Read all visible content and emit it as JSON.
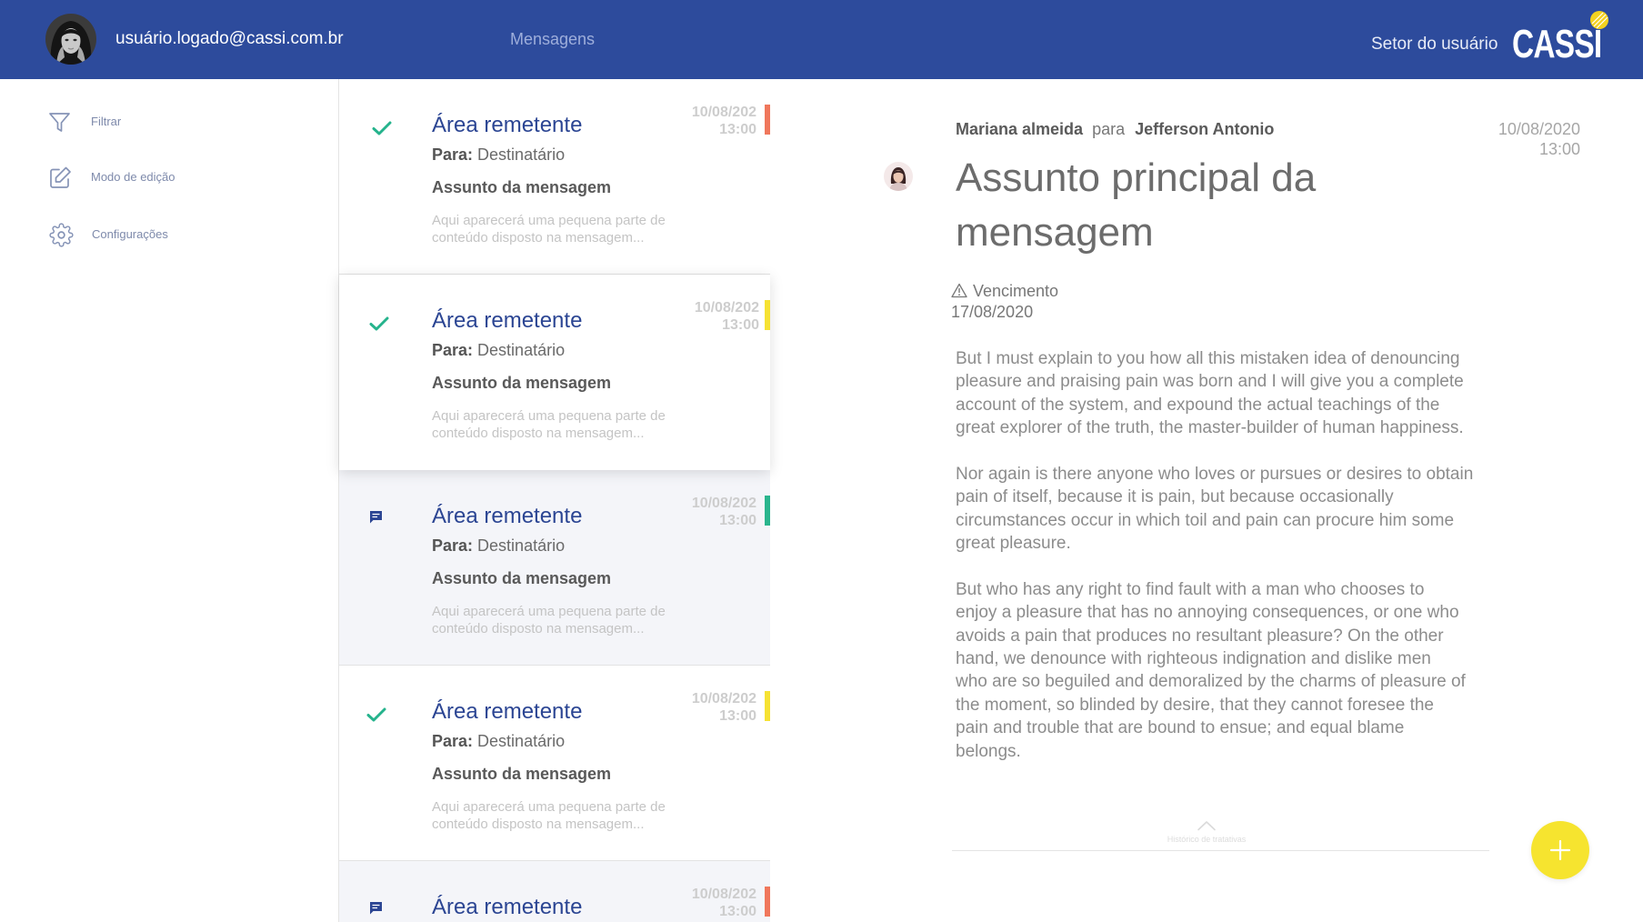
{
  "header": {
    "user_email": "usuário.logado@cassi.com.br",
    "nav_label": "Mensagens",
    "sector_label": "Setor do usuário",
    "logo_text": "CASSI",
    "background": "#2d4b9c"
  },
  "sidebar": {
    "items": [
      {
        "label": "Filtrar",
        "icon": "filter-icon"
      },
      {
        "label": "Modo de edição",
        "icon": "edit-icon"
      },
      {
        "label": "Configurações",
        "icon": "gear-icon"
      }
    ]
  },
  "messages": [
    {
      "sender_area": "Área remetente",
      "to_label": "Para:",
      "to_value": "Destinatário",
      "subject": "Assunto da mensagem",
      "preview_lines": [
        "Aqui aparecerá uma pequena parte de",
        "conteúdo disposto na mensagem..."
      ],
      "date": "10/08/202",
      "time": "13:00",
      "status_icon": "check-icon",
      "priority_color": "#f0775c"
    },
    {
      "sender_area": "Área remetente",
      "to_label": "Para:",
      "to_value": "Destinatário",
      "subject": "Assunto da mensagem",
      "preview_lines": [
        "Aqui aparecerá uma pequena parte de",
        "conteúdo disposto na mensagem..."
      ],
      "date": "10/08/202",
      "time": "13:00",
      "status_icon": "check-icon",
      "priority_color": "#f6e233"
    },
    {
      "sender_area": "Área remetente",
      "to_label": "Para:",
      "to_value": "Destinatário",
      "subject": "Assunto da mensagem",
      "preview_lines": [
        "Aqui aparecerá uma pequena parte de",
        "conteúdo disposto na mensagem..."
      ],
      "date": "10/08/202",
      "time": "13:00",
      "status_icon": "chat-icon",
      "priority_color": "#2ab58d"
    },
    {
      "sender_area": "Área remetente",
      "to_label": "Para:",
      "to_value": "Destinatário",
      "subject": "Assunto da mensagem",
      "preview_lines": [
        "Aqui aparecerá uma pequena parte de",
        "conteúdo disposto na mensagem..."
      ],
      "date": "10/08/202",
      "time": "13:00",
      "status_icon": "check-icon",
      "priority_color": "#f6e233"
    },
    {
      "sender_area": "Área remetente",
      "date": "10/08/202",
      "time": "13:00",
      "status_icon": "chat-icon",
      "priority_color": "#f0775c"
    }
  ],
  "detail": {
    "from": "Mariana almeida",
    "to_word": "para",
    "to": "Jefferson Antonio",
    "date": "10/08/2020",
    "time": "13:00",
    "subject": "Assunto principal da mensagem",
    "due_label": "Vencimento",
    "due_date": "17/08/2020",
    "body": [
      [
        "But I must explain to you how all this mistaken idea of denouncing",
        "pleasure and praising pain was born and I will give you a complete",
        "account of the system, and expound the actual teachings of the",
        "great explorer of the truth, the master-builder of human happiness."
      ],
      [
        "Nor again is there anyone who loves or pursues or desires to obtain",
        "pain of itself, because it is pain, but because occasionally",
        "circumstances occur in which toil and pain can procure him some",
        "great pleasure."
      ],
      [
        "But who has any right to find fault with a man who chooses to",
        "enjoy a pleasure that has no annoying consequences, or one who",
        "avoids a pain that produces no resultant pleasure? On the other",
        "hand, we denounce with righteous indignation and dislike men",
        "who are so beguiled and demoralized by the charms of pleasure of",
        "the moment, so blinded by desire, that they cannot foresee the",
        "pain and trouble that are bound to ensue; and equal blame",
        "belongs."
      ]
    ],
    "history_label": "Histórico de tratativas"
  },
  "fab": {
    "icon": "plus-icon",
    "color": "#f6e42f"
  },
  "colors": {
    "accent": "#2b4593",
    "read_check": "#25b38c"
  }
}
